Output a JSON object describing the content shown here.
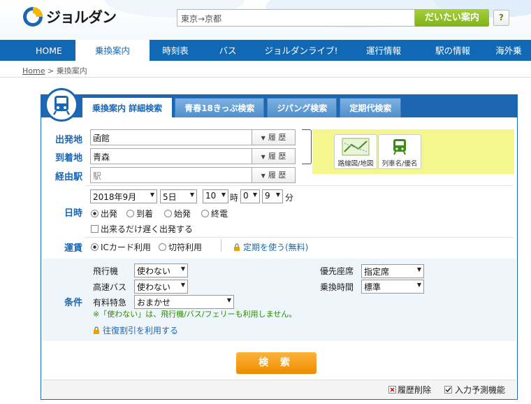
{
  "header": {
    "logo_text": "ジョルダン",
    "search_value": "東京→京都",
    "search_button": "だいたい案内",
    "help_button": "?"
  },
  "nav": {
    "items": [
      "HOME",
      "乗換案内",
      "時刻表",
      "バス",
      "ジョルダンライブ!",
      "運行情報",
      "駅の情報",
      "海外乗"
    ]
  },
  "breadcrumb": {
    "home": "Home",
    "sep": ">",
    "current": "乗換案内"
  },
  "tabs": [
    "乗換案内 詳細検索",
    "青春18きっぷ検索",
    "ジパング検索",
    "定期代検索"
  ],
  "route": {
    "from_label": "出発地",
    "from_value": "函館",
    "to_label": "到着地",
    "to_value": "青森",
    "via_label": "経由駅",
    "via_placeholder": "駅",
    "history": "履 歴"
  },
  "map_buttons": {
    "route_map": "路線図/地図",
    "train_name": "列車名/優名"
  },
  "datetime": {
    "label": "日時",
    "year_month": "2018年9月",
    "day": "5日",
    "hour": "10",
    "hour_unit": "時",
    "min1": "0",
    "min2": "9",
    "min_unit": "分",
    "opts": [
      "出発",
      "到着",
      "始発",
      "終電"
    ],
    "late": "出来るだけ遅く出発する"
  },
  "fare": {
    "label": "運賃",
    "opts": [
      "ICカード利用",
      "切符利用"
    ],
    "commuter": "定期を使う(無料)"
  },
  "conditions": {
    "label": "条件",
    "flight": "飛行機",
    "flight_val": "使わない",
    "bus": "高速バス",
    "bus_val": "使わない",
    "express": "有料特急",
    "express_val": "おまかせ",
    "seat": "優先座席",
    "seat_val": "指定席",
    "transfer": "乗換時間",
    "transfer_val": "標準",
    "note": "※「使わない」は、飛行機/バス/フェリーも利用しません。",
    "roundtrip": "往復割引を利用する"
  },
  "search_button": "検 索",
  "footer": {
    "delete_history": "履歴削除",
    "predict": "入力予測機能"
  }
}
